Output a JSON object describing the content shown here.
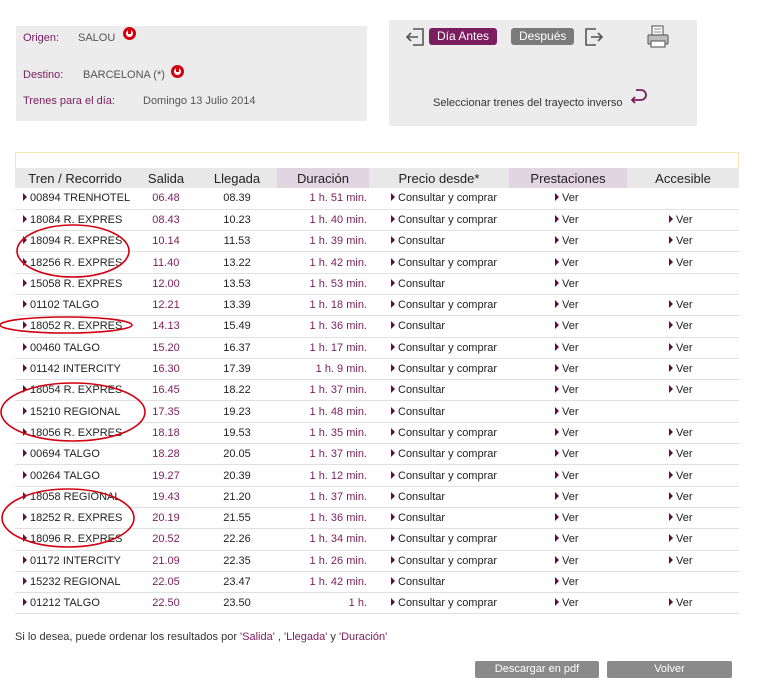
{
  "search": {
    "origin_label": "Origen:",
    "origin_value": "SALOU",
    "destination_label": "Destino:",
    "destination_value": "BARCELONA (*)",
    "date_label": "Trenes para el día:",
    "date_value": "Domingo  13  Julio  2014"
  },
  "nav": {
    "prev_label": "Día Antes",
    "next_label": "Después",
    "inverse_label": "Seleccionar trenes del trayecto inverso"
  },
  "table": {
    "headers": [
      "Tren / Recorrido",
      "Salida",
      "Llegada",
      "Duración",
      "Precio desde*",
      "Prestaciones",
      "Accesible"
    ],
    "rows": [
      {
        "tren": "00894 TRENHOTEL",
        "salida": "06.48",
        "llegada": "08.39",
        "duracion": "1 h. 51 min.",
        "precio": "Consultar y comprar",
        "prestaciones": "Ver",
        "accesible": ""
      },
      {
        "tren": "18084 R. EXPRES",
        "salida": "08.43",
        "llegada": "10.23",
        "duracion": "1 h. 40 min.",
        "precio": "Consultar y comprar",
        "prestaciones": "Ver",
        "accesible": "Ver"
      },
      {
        "tren": "18094 R. EXPRES",
        "salida": "10.14",
        "llegada": "11.53",
        "duracion": "1 h. 39 min.",
        "precio": "Consultar",
        "prestaciones": "Ver",
        "accesible": "Ver"
      },
      {
        "tren": "18256 R. EXPRES",
        "salida": "11.40",
        "llegada": "13.22",
        "duracion": "1 h. 42 min.",
        "precio": "Consultar y comprar",
        "prestaciones": "Ver",
        "accesible": "Ver"
      },
      {
        "tren": "15058 R. EXPRES",
        "salida": "12.00",
        "llegada": "13.53",
        "duracion": "1 h. 53 min.",
        "precio": "Consultar",
        "prestaciones": "Ver",
        "accesible": ""
      },
      {
        "tren": "01102 TALGO",
        "salida": "12.21",
        "llegada": "13.39",
        "duracion": "1 h. 18 min.",
        "precio": "Consultar y comprar",
        "prestaciones": "Ver",
        "accesible": "Ver"
      },
      {
        "tren": "18052 R. EXPRES",
        "salida": "14.13",
        "llegada": "15.49",
        "duracion": "1 h. 36 min.",
        "precio": "Consultar",
        "prestaciones": "Ver",
        "accesible": "Ver"
      },
      {
        "tren": "00460 TALGO",
        "salida": "15.20",
        "llegada": "16.37",
        "duracion": "1 h. 17 min.",
        "precio": "Consultar y comprar",
        "prestaciones": "Ver",
        "accesible": "Ver"
      },
      {
        "tren": "01142 INTERCITY",
        "salida": "16.30",
        "llegada": "17.39",
        "duracion": "1 h. 9 min.",
        "precio": "Consultar y comprar",
        "prestaciones": "Ver",
        "accesible": "Ver"
      },
      {
        "tren": "18054 R. EXPRES",
        "salida": "16.45",
        "llegada": "18.22",
        "duracion": "1 h. 37 min.",
        "precio": "Consultar",
        "prestaciones": "Ver",
        "accesible": "Ver"
      },
      {
        "tren": "15210 REGIONAL",
        "salida": "17.35",
        "llegada": "19.23",
        "duracion": "1 h. 48 min.",
        "precio": "Consultar",
        "prestaciones": "Ver",
        "accesible": ""
      },
      {
        "tren": "18056 R. EXPRES",
        "salida": "18.18",
        "llegada": "19.53",
        "duracion": "1 h. 35 min.",
        "precio": "Consultar y comprar",
        "prestaciones": "Ver",
        "accesible": "Ver"
      },
      {
        "tren": "00694 TALGO",
        "salida": "18.28",
        "llegada": "20.05",
        "duracion": "1 h. 37 min.",
        "precio": "Consultar y comprar",
        "prestaciones": "Ver",
        "accesible": "Ver"
      },
      {
        "tren": "00264 TALGO",
        "salida": "19.27",
        "llegada": "20.39",
        "duracion": "1 h. 12 min.",
        "precio": "Consultar y comprar",
        "prestaciones": "Ver",
        "accesible": "Ver"
      },
      {
        "tren": "18058 REGIONAL",
        "salida": "19.43",
        "llegada": "21.20",
        "duracion": "1 h. 37 min.",
        "precio": "Consultar",
        "prestaciones": "Ver",
        "accesible": "Ver"
      },
      {
        "tren": "18252 R. EXPRES",
        "salida": "20.19",
        "llegada": "21.55",
        "duracion": "1 h. 36 min.",
        "precio": "Consultar",
        "prestaciones": "Ver",
        "accesible": "Ver"
      },
      {
        "tren": "18096 R. EXPRES",
        "salida": "20.52",
        "llegada": "22.26",
        "duracion": "1 h. 34 min.",
        "precio": "Consultar y comprar",
        "prestaciones": "Ver",
        "accesible": "Ver"
      },
      {
        "tren": "01172 INTERCITY",
        "salida": "21.09",
        "llegada": "22.35",
        "duracion": "1 h. 26 min.",
        "precio": "Consultar y comprar",
        "prestaciones": "Ver",
        "accesible": "Ver"
      },
      {
        "tren": "15232 REGIONAL",
        "salida": "22.05",
        "llegada": "23.47",
        "duracion": "1 h. 42 min.",
        "precio": "Consultar",
        "prestaciones": "Ver",
        "accesible": ""
      },
      {
        "tren": "01212 TALGO",
        "salida": "22.50",
        "llegada": "23.50",
        "duracion": "1 h.",
        "precio": "Consultar y comprar",
        "prestaciones": "Ver",
        "accesible": "Ver"
      }
    ]
  },
  "footer": {
    "sort_prefix": "Si lo desea, puede ordenar los resultados por ",
    "sort_salida": "'Salida'",
    "sort_sep1": " , ",
    "sort_llegada": "'Llegada'",
    "sort_sep2": " y ",
    "sort_duracion": "'Duración'",
    "pdf_button": "Descargar en pdf",
    "back_button": "Volver"
  },
  "colors": {
    "accent": "#7b1d5e",
    "annotation_circle": "#d10010",
    "panel_bg": "#ececec"
  },
  "icons": [
    "info-icon",
    "exit-left-icon",
    "exit-right-icon",
    "printer-icon",
    "return-arrow-icon",
    "triangle-bullet-icon"
  ]
}
